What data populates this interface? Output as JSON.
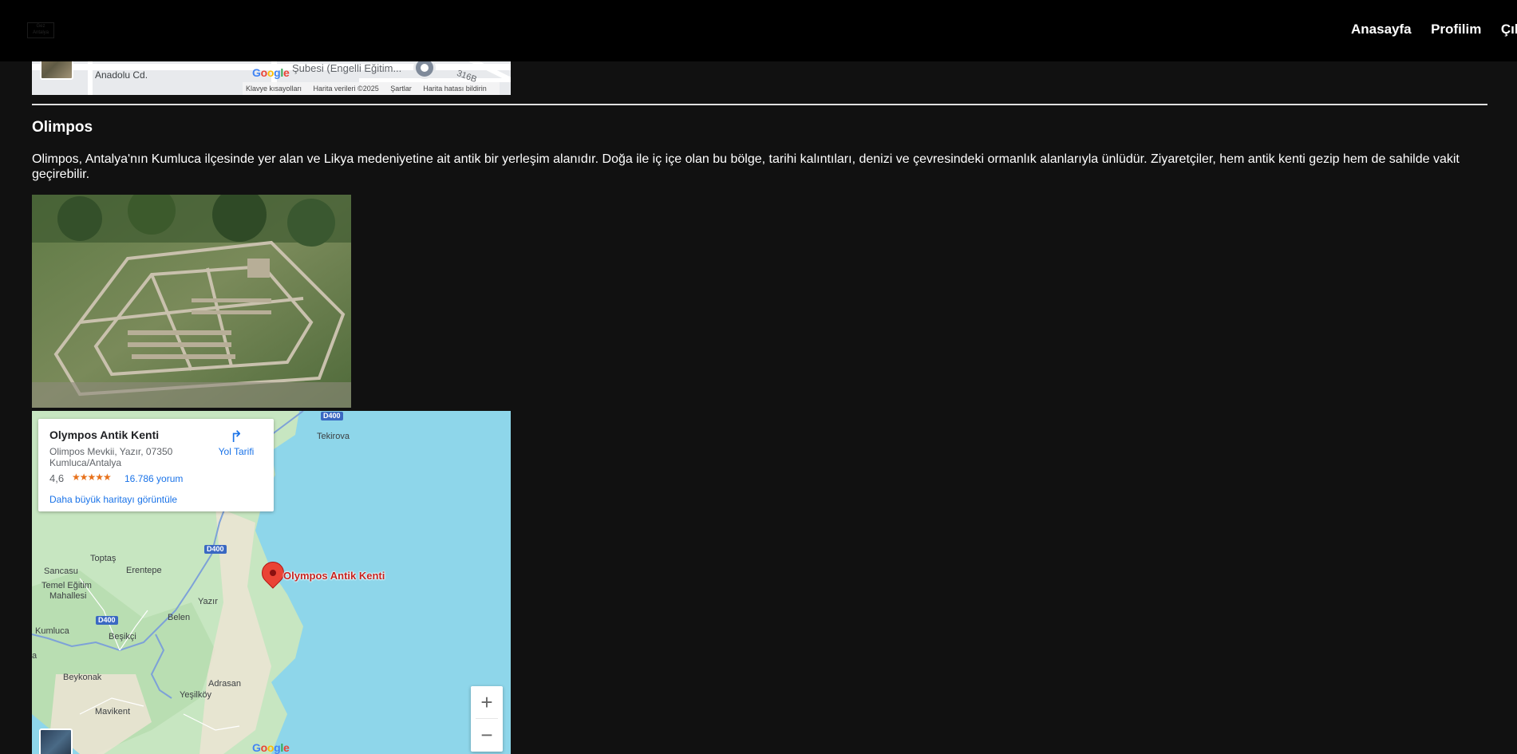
{
  "header": {
    "logo_text": "Gez Antalya",
    "nav": [
      "Anasayfa",
      "Profilim",
      "Çıkış"
    ]
  },
  "top_map": {
    "street": "Anadolu Cd.",
    "place": "Şubesi (Engelli Eğitim...",
    "road_number": "316B",
    "google": [
      "G",
      "o",
      "o",
      "g",
      "l",
      "e"
    ],
    "attribution": [
      "Klavye kısayolları",
      "Harita verileri ©2025",
      "Şartlar",
      "Harita hatası bildirin"
    ]
  },
  "content": {
    "title": "Olimpos",
    "description": "Olimpos, Antalya'nın Kumluca ilçesinde yer alan ve Likya medeniyetine ait antik bir yerleşim alanıdır. Doğa ile iç içe olan bu bölge, tarihi kalıntıları, denizi ve çevresindeki ormanlık alanlarıyla ünlüdür. Ziyaretçiler, hem antik kenti gezip hem de sahilde vakit geçirebilir."
  },
  "map": {
    "info": {
      "name": "Olympos Antik Kenti",
      "address": "Olimpos Mevkii, Yazır, 07350 Kumluca/Antalya",
      "rating": "4,6",
      "stars": "★★★★★",
      "reviews": "16.786 yorum",
      "bigger_map": "Daha büyük haritayı görüntüle",
      "directions": "Yol Tarifi"
    },
    "marker_label": "Olympos Antik Kenti",
    "labels": {
      "tekirova": "Tekirova",
      "toptas": "Toptaş",
      "erentepe": "Erentepe",
      "sancasu": "Sancasu",
      "temel_egitim": "Temel Eğitim",
      "mahallesi": "Mahallesi",
      "yazir": "Yazır",
      "belen": "Belen",
      "kumluca": "Kumluca",
      "besikci": "Beşikçi",
      "beykonak": "Beykonak",
      "yesilkoy": "Yeşilköy",
      "adrasan": "Adrasan",
      "mavikent": "Mavikent",
      "edge_a": "a"
    },
    "shields": [
      "D400",
      "D400",
      "D400"
    ],
    "zoom_in": "+",
    "zoom_out": "−",
    "google": [
      "G",
      "o",
      "o",
      "g",
      "l",
      "e"
    ]
  },
  "colors": {
    "background": "#111111",
    "header": "#000000",
    "link": "#1a73e8",
    "pin": "#ea4335",
    "sea": "#8ed6ea",
    "land": "#c7e6c1"
  }
}
